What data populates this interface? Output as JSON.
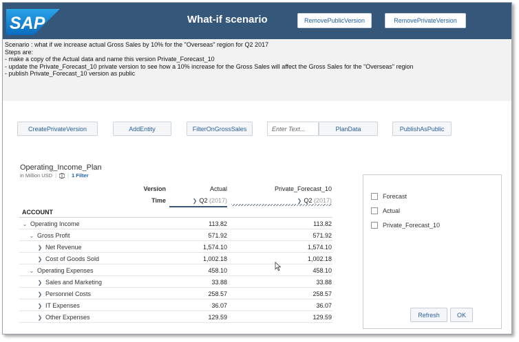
{
  "header": {
    "logo_text": "SAP",
    "title": "What-if scenario",
    "remove_public_label": "RemovePublicVersion",
    "remove_private_label": "RemovePrivateVersion",
    "colors": {
      "bar": "#34577a",
      "logo": "#1a8fd8"
    }
  },
  "scenario": {
    "lines": [
      "Scenario : what if we increase actual Gross Sales by 10% for the \"Overseas\" region for Q2 2017",
      "Steps are:",
      "- make a copy of the Actual data and name this version Private_Forecast_10",
      "- update the Private_Forecast_10 private version to see how a 10% increase for the Gross Sales will affect the Gross Sales for the \"Overseas\" region",
      "- publish Private_Forecast_10 version as public"
    ]
  },
  "toolbar": {
    "create_private_label": "CreatePrivateVersion",
    "add_entity_label": "AddEntity",
    "filter_gross_label": "FilterOnGrossSales",
    "input_placeholder": "Enter Text...",
    "plan_data_label": "PlanData",
    "publish_public_label": "PublishAsPublic"
  },
  "table": {
    "title": "Operating_Income_Plan",
    "unit": "in Million USD",
    "filter_label": "1 Filter",
    "version_label": "Version",
    "time_label": "Time",
    "account_label": "ACCOUNT",
    "col_actual": "Actual",
    "col_private": "Private_Forecast_10",
    "time_actual": "Q2",
    "time_actual_year": "(2017)",
    "time_private": "Q2",
    "time_private_year": "(2017)",
    "rows": [
      {
        "name": "Operating Income",
        "actual": "113.82",
        "forecast": "113.82"
      },
      {
        "name": "Gross Profit",
        "actual": "571.92",
        "forecast": "571.92"
      },
      {
        "name": "Net Revenue",
        "actual": "1,574.10",
        "forecast": "1,574.10"
      },
      {
        "name": "Cost of Goods Sold",
        "actual": "1,002.18",
        "forecast": "1,002.18"
      },
      {
        "name": "Operating Expenses",
        "actual": "458.10",
        "forecast": "458.10"
      },
      {
        "name": "Sales and Marketing",
        "actual": "33.88",
        "forecast": "33.88"
      },
      {
        "name": "Personnel Costs",
        "actual": "258.57",
        "forecast": "258.57"
      },
      {
        "name": "IT Expenses",
        "actual": "36.07",
        "forecast": "36.07"
      },
      {
        "name": "Other Expenses",
        "actual": "129.59",
        "forecast": "129.59"
      }
    ]
  },
  "panel": {
    "options": [
      "Forecast",
      "Actual",
      "Private_Forecast_10"
    ],
    "refresh_label": "Refresh",
    "ok_label": "OK"
  }
}
